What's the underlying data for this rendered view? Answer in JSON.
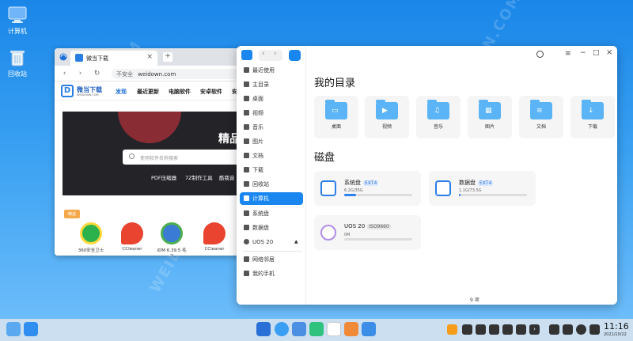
{
  "desktop": {
    "icons": [
      {
        "label": "计算机"
      },
      {
        "label": "回收站"
      }
    ],
    "watermark": "WEIDOWN.COM"
  },
  "browser": {
    "tab_title": "微当下载",
    "new_tab": "+",
    "close": "×",
    "url_prefix": "不安全",
    "url": "weidown.com",
    "site_logo_text": "微当下载",
    "site_logo_sub": "WEIDOWN.COM",
    "nav": [
      "发现",
      "最近更新",
      "电脑软件",
      "安卓软件",
      "安"
    ],
    "banner_title": "精品",
    "search_placeholder": "使用软件名称搜索",
    "hot_links": [
      "PDF压缩器",
      "7Z制作工具",
      "酷我音"
    ],
    "badge": "精选",
    "apps": [
      "360安全卫士",
      "CCleaner",
      "IDM 6.39.5 毛子",
      "CCleaner"
    ]
  },
  "file_manager": {
    "sidebar": [
      {
        "label": "最近使用"
      },
      {
        "label": "主目录"
      },
      {
        "label": "桌面"
      },
      {
        "label": "视频"
      },
      {
        "label": "音乐"
      },
      {
        "label": "图片"
      },
      {
        "label": "文档"
      },
      {
        "label": "下载"
      },
      {
        "label": "回收站"
      },
      {
        "label": "计算机"
      },
      {
        "label": "系统盘"
      },
      {
        "label": "数据盘"
      },
      {
        "label": "UOS 20"
      },
      {
        "label": "网络邻居"
      },
      {
        "label": "我的手机"
      }
    ],
    "my_dirs_title": "我的目录",
    "folders": [
      "桌面",
      "视频",
      "音乐",
      "图片",
      "文档",
      "下载"
    ],
    "disks_title": "磁盘",
    "disks": [
      {
        "name": "系统盘",
        "fs": "EXT4",
        "size": "6.2G/35G",
        "used": 0.18
      },
      {
        "name": "数据盘",
        "fs": "EXT4",
        "size": "1.1G/73.5G",
        "used": 0.02
      },
      {
        "name": "UOS 20",
        "fs": "ISO9660",
        "size": "0M",
        "used": 0
      }
    ],
    "status": "9 项",
    "window_buttons": [
      "−",
      "□",
      "×"
    ]
  },
  "taskbar": {
    "time": "11:16",
    "date": "2021/10/22"
  }
}
